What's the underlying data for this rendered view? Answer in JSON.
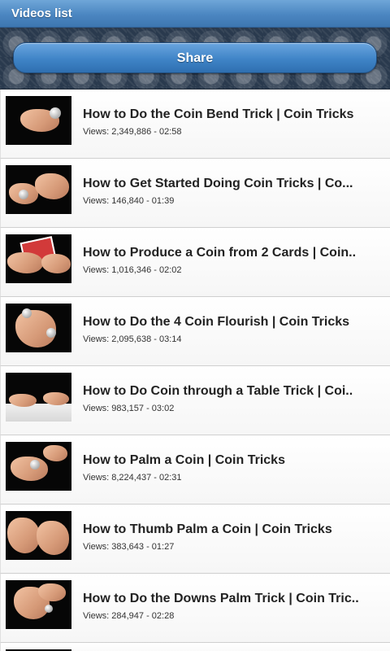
{
  "titlebar": {
    "title": "Videos list"
  },
  "banner": {
    "share_label": "Share"
  },
  "colors": {
    "titlebar_blue": "#4b86c1",
    "button_blue": "#3f84c7",
    "banner_dark": "#2a3a4e"
  },
  "videos": [
    {
      "title": "How to Do the Coin Bend Trick | Coin Tricks",
      "views": "2,349,886",
      "duration": "02:58",
      "meta": "Views: 2,349,886 - 02:58",
      "thumbnail": "hands-coin-bend"
    },
    {
      "title": "How to Get Started Doing Coin Tricks | Co...",
      "views": "146,840",
      "duration": "01:39",
      "meta": "Views: 146,840 - 01:39",
      "thumbnail": "hands-coin-start"
    },
    {
      "title": "How to Produce a Coin from 2 Cards | Coin..",
      "views": "1,016,346",
      "duration": "02:02",
      "meta": "Views: 1,016,346 - 02:02",
      "thumbnail": "hands-cards"
    },
    {
      "title": "How to Do the 4 Coin Flourish | Coin Tricks",
      "views": "2,095,638",
      "duration": "03:14",
      "meta": "Views: 2,095,638 - 03:14",
      "thumbnail": "hands-four-coins"
    },
    {
      "title": "How to Do Coin through a Table Trick | Coi..",
      "views": "983,157",
      "duration": "03:02",
      "meta": "Views: 983,157 - 03:02",
      "thumbnail": "hands-table"
    },
    {
      "title": "How to Palm a Coin | Coin Tricks",
      "views": "8,224,437",
      "duration": "02:31",
      "meta": "Views: 8,224,437 - 02:31",
      "thumbnail": "hand-palm-coin"
    },
    {
      "title": "How to Thumb Palm a Coin | Coin Tricks",
      "views": "383,643",
      "duration": "01:27",
      "meta": "Views: 383,643 - 01:27",
      "thumbnail": "hands-thumb-palm"
    },
    {
      "title": "How to Do the Downs Palm Trick | Coin Tric..",
      "views": "284,947",
      "duration": "02:28",
      "meta": "Views: 284,947 - 02:28",
      "thumbnail": "hands-downs-palm"
    }
  ]
}
